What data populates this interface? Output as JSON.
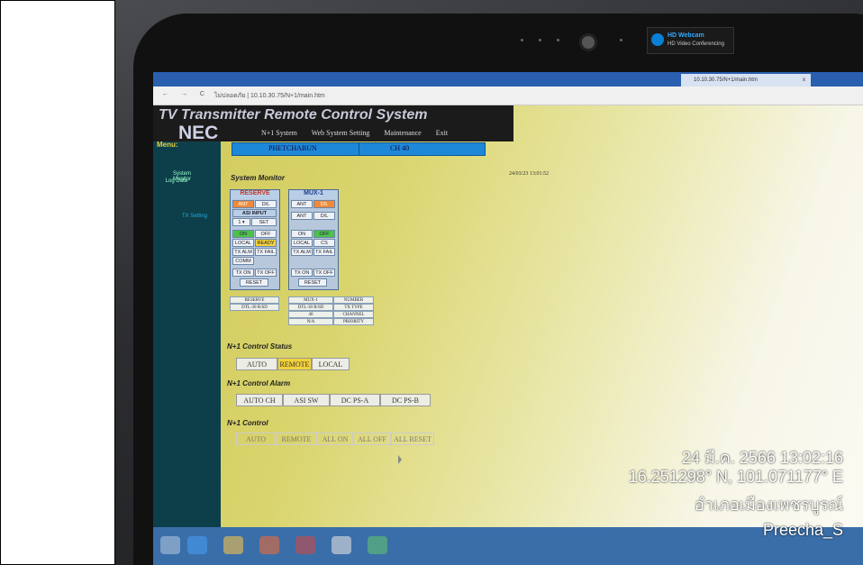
{
  "browser": {
    "tab_label": "10.10.30.75/N+1/main.htm",
    "tab_close": "x",
    "nav": "← → C",
    "url": "ไม่ปลอดภัย | 10.10.30.75/N+1/main.htm"
  },
  "webcam_badge": {
    "title": "HD Webcam",
    "subtitle": "HD Video Conferencing"
  },
  "app": {
    "title": "TV Transmitter Remote Control System",
    "logo": "NEC",
    "nav": [
      "N+1 System",
      "Web System Setting",
      "Maintenance",
      "Exit"
    ],
    "menu_label": "Menu:",
    "sidebar": [
      "System Monitor",
      "Log Data",
      "TX Setting"
    ],
    "station": "PHETCHABUN",
    "channel": "CH 40"
  },
  "monitor": {
    "heading": "System Monitor",
    "timestamp": "24/03/23 13:01:52",
    "reserve": {
      "title": "RESERVE",
      "ant": "ANT",
      "dl": "D/L",
      "asi_input": "ASI INPUT",
      "select": "1 ▾",
      "set": "SET",
      "on": "ON",
      "off": "OFF",
      "local": "LOCAL",
      "ready": "READY",
      "tx_alm": "TX ALM",
      "tx_fail": "TX FAIL",
      "comm": "COMM",
      "tx_on": "TX ON",
      "tx_off": "TX OFF",
      "reset": "RESET"
    },
    "mux": {
      "title": "MUX-1",
      "ant": "ANT",
      "dl": "D/L",
      "ant2": "ANT",
      "dl2": "D/L",
      "on": "ON",
      "off": "OFF",
      "local": "LOCAL",
      "cs": "CS",
      "tx_alm": "TX ALM",
      "tx_fail": "TX FAIL",
      "tx_on": "TX ON",
      "tx_off": "TX OFF",
      "reset": "RESET"
    },
    "info": {
      "reserve_col": [
        "RESERVE",
        "DTL-30 R/SD"
      ],
      "mux_col": [
        "MUX-1",
        "DTL-30 R/SD",
        "40",
        "N/A"
      ],
      "labels": [
        "NUMBER",
        "TX TYPE",
        "CHANNEL",
        "PRIORITY"
      ]
    }
  },
  "status": {
    "heading": "N+1 Control Status",
    "buttons": [
      "AUTO",
      "REMOTE",
      "LOCAL"
    ]
  },
  "alarm": {
    "heading": "N+1 Control Alarm",
    "buttons": [
      "AUTO CH",
      "ASI SW",
      "DC PS-A",
      "DC PS-B"
    ]
  },
  "control": {
    "heading": "N+1 Control",
    "buttons": [
      "AUTO",
      "REMOTE",
      "ALL ON",
      "ALL OFF",
      "ALL RESET"
    ]
  },
  "overlay": {
    "datetime": "24 มี.ค. 2566 13:02:16",
    "coords": "16.251298° N, 101.071177° E",
    "location": "อำเภอเมืองเพชรบูรณ์",
    "user": "Preecha_S"
  },
  "colors": {
    "orange": "#f08a3a",
    "green": "#4cc24a",
    "yellow": "#f2d23a",
    "accent_blue": "#1e88d8"
  }
}
